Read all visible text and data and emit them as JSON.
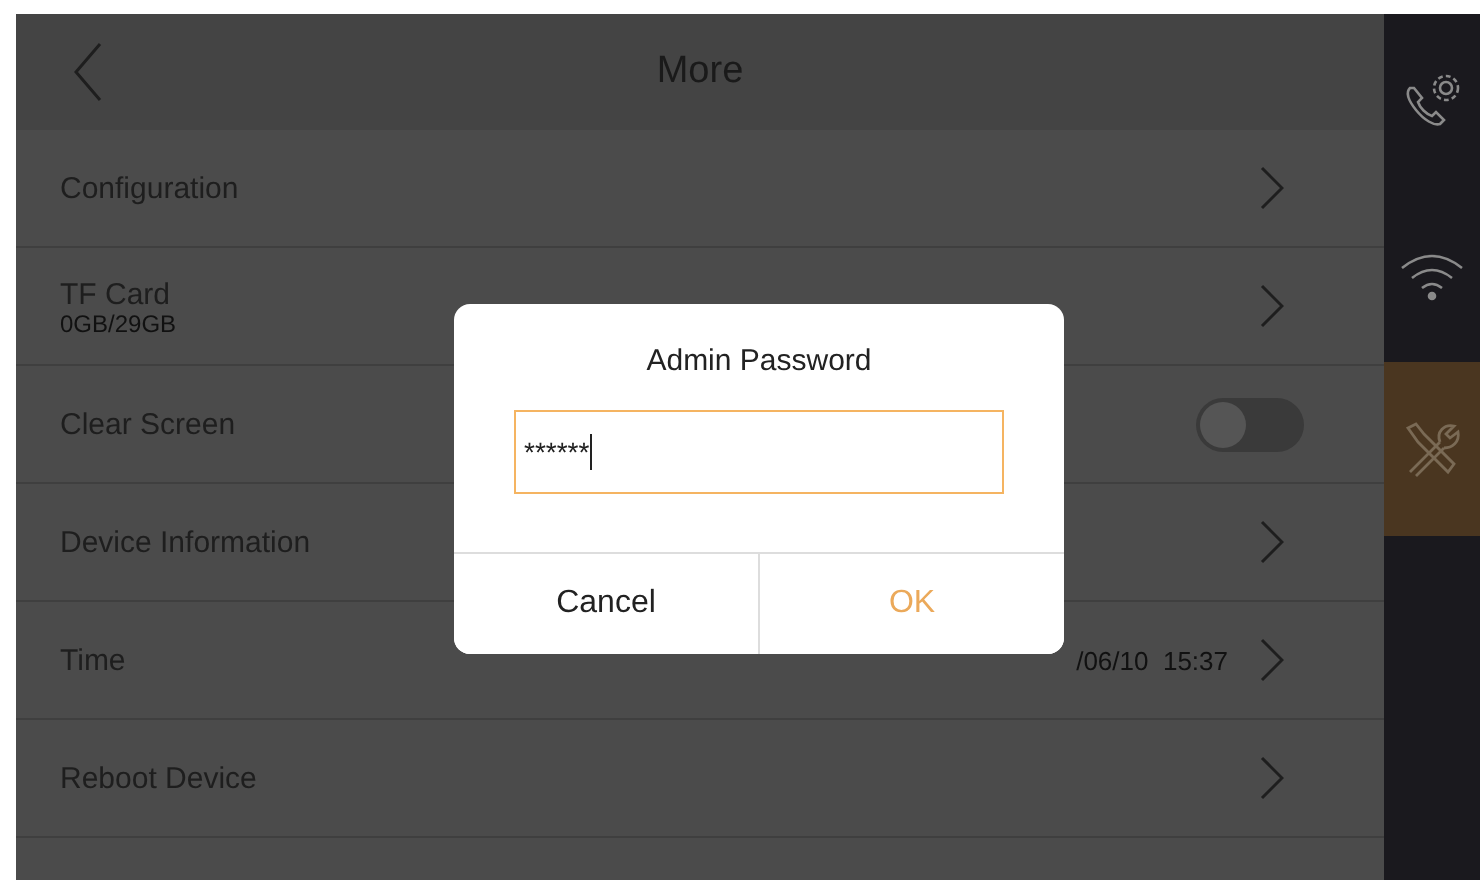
{
  "header": {
    "title": "More"
  },
  "items": [
    {
      "kind": "link",
      "label": "Configuration"
    },
    {
      "kind": "link",
      "label": "TF Card",
      "sublabel": "0GB/29GB"
    },
    {
      "kind": "toggle",
      "label": "Clear Screen",
      "on": false
    },
    {
      "kind": "link",
      "label": "Device Information"
    },
    {
      "kind": "link",
      "label": "Time",
      "value": "/06/10  15:37"
    },
    {
      "kind": "link",
      "label": "Reboot Device"
    }
  ],
  "sidebar": [
    {
      "kind": "call",
      "selected": false
    },
    {
      "kind": "network",
      "selected": false
    },
    {
      "kind": "maintenance",
      "selected": true
    }
  ],
  "dialog": {
    "title": "Admin Password",
    "value": "******",
    "buttons": [
      {
        "label": "Cancel",
        "kind": "cancel"
      },
      {
        "label": "OK",
        "kind": "confirm"
      }
    ]
  }
}
